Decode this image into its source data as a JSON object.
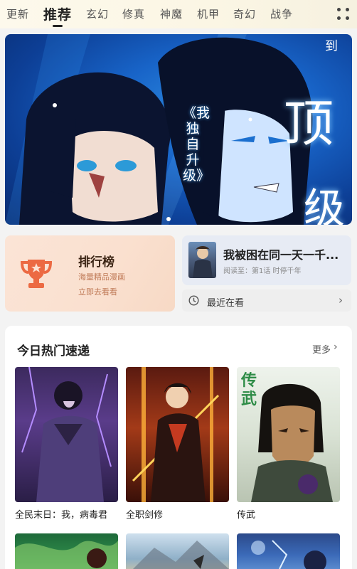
{
  "tabs": [
    {
      "label": "更新",
      "active": false
    },
    {
      "label": "推荐",
      "active": true
    },
    {
      "label": "玄幻",
      "active": false
    },
    {
      "label": "修真",
      "active": false
    },
    {
      "label": "神魔",
      "active": false
    },
    {
      "label": "机甲",
      "active": false
    },
    {
      "label": "奇幻",
      "active": false
    },
    {
      "label": "战争",
      "active": false
    }
  ],
  "banner": {
    "vertical_title": "《我独自升级》",
    "big_text_1": "顶",
    "big_text_2": "级",
    "corner_text": "到"
  },
  "ranking": {
    "title": "排行榜",
    "subtitle_1": "海量精品漫画",
    "subtitle_2": "立即去看看"
  },
  "continue_reading": {
    "title": "我被困在同一天一千...",
    "progress": "阅读至：第1话 时停千年"
  },
  "recent": {
    "label": "最近在看"
  },
  "hot": {
    "title": "今日热门速递",
    "more": "更多",
    "items": [
      {
        "title": "全民末日：我，病毒君"
      },
      {
        "title": "全职剑修"
      },
      {
        "title": "传武",
        "cover_text": "传武"
      }
    ]
  },
  "colors": {
    "accent": "#e9623b",
    "banner_blue": "#1864c8"
  },
  "icons": [
    "grid-menu-icon",
    "trophy-icon",
    "clock-icon",
    "chevron-right-icon"
  ]
}
